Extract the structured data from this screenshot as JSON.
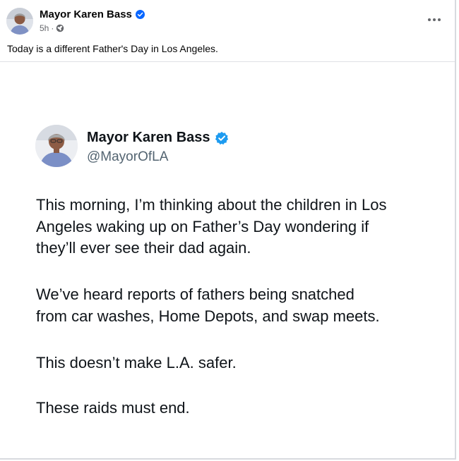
{
  "post": {
    "author": "Mayor Karen Bass",
    "time": "5h",
    "separator": "·",
    "caption": "Today is a different Father's Day in Los Angeles."
  },
  "tweet": {
    "name": "Mayor Karen Bass",
    "handle": "@MayorOfLA",
    "paragraphs": [
      [
        "This morning, I’m thinking about the children in Los",
        "Angeles waking up on Father’s Day wondering if",
        "they’ll ever see their dad again."
      ],
      [
        "We’ve heard reports of fathers being snatched",
        "from car washes, Home Depots, and swap meets."
      ],
      [
        "This doesn’t make L.A. safer."
      ],
      [
        "These raids must end."
      ]
    ]
  },
  "icons": {
    "verified": "verified-badge-icon",
    "audience": "globe-icon",
    "more": "more-options-icon"
  },
  "colors": {
    "verified_blue": "#0866ff",
    "secondary_text": "#65676b",
    "tweet_handle": "#536471"
  }
}
